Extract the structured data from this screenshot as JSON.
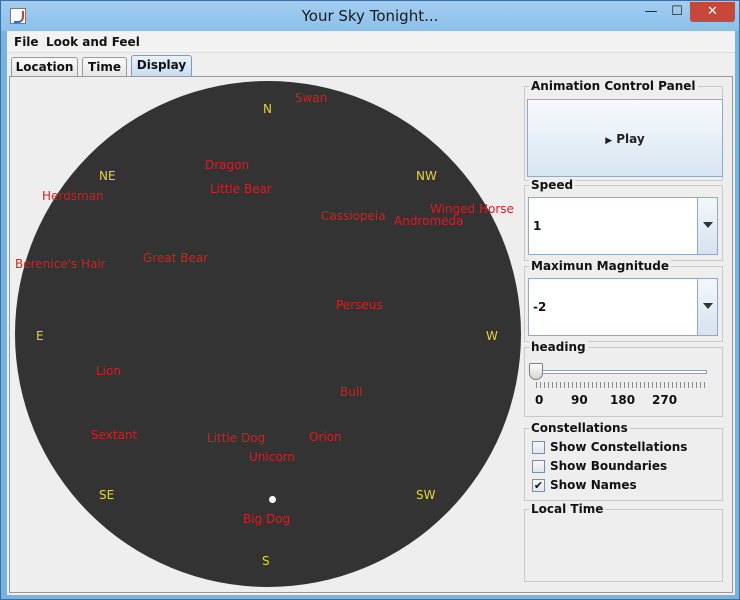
{
  "window": {
    "title": "Your Sky Tonight...",
    "min_glyph": "—",
    "max_glyph": "☐",
    "close_glyph": "✕"
  },
  "menu": [
    "File",
    "Look and Feel"
  ],
  "tabs": [
    {
      "label": "Location",
      "active": false
    },
    {
      "label": "Time",
      "active": false
    },
    {
      "label": "Display",
      "active": true
    }
  ],
  "sky": {
    "background": "#333333",
    "direction_color": "#e7d33a",
    "constellation_color": "#d61e1e",
    "directions": {
      "n": "N",
      "ne": "NE",
      "nw": "NW",
      "e": "E",
      "w": "W",
      "se": "SE",
      "sw": "SW",
      "s": "S"
    },
    "constellations": {
      "swan": "Swan",
      "dragon": "Dragon",
      "little_bear": "Little Bear",
      "herdsman": "Herdsman",
      "cassiopeia": "Cassiopeia",
      "andromeda": "Andromeda",
      "winged_horse": "Winged Horse",
      "berenices_hair": "Berenice's Hair",
      "great_bear": "Great Bear",
      "perseus": "Perseus",
      "lion": "Lion",
      "bull": "Bull",
      "sextant": "Sextant",
      "little_dog": "Little Dog",
      "orion": "Orion",
      "unicorn": "Unicorn",
      "big_dog": "Big Dog"
    }
  },
  "panel": {
    "animation": {
      "title": "Animation Control Panel",
      "play_label": "Play"
    },
    "speed": {
      "title": "Speed",
      "value": "1"
    },
    "magnitude": {
      "title": "Maximun Magnitude",
      "value": "-2"
    },
    "heading": {
      "title": "heading",
      "value_degrees": 0,
      "ticks": [
        "0",
        "90",
        "180",
        "270"
      ]
    },
    "constellations": {
      "title": "Constellations",
      "options": [
        {
          "label": "Show Constellations",
          "checked": false
        },
        {
          "label": "Show Boundaries",
          "checked": false
        },
        {
          "label": "Show Names",
          "checked": true
        }
      ]
    },
    "local_time": {
      "title": "Local Time",
      "value": ""
    }
  }
}
